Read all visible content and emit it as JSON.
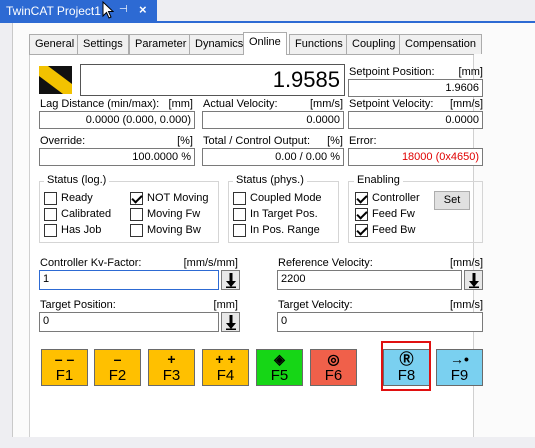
{
  "doc_tab": {
    "title": "TwinCAT Project1",
    "pin_glyph": "⊣",
    "close_glyph": "×"
  },
  "tabs": [
    {
      "label": "General"
    },
    {
      "label": "Settings"
    },
    {
      "label": "Parameter"
    },
    {
      "label": "Dynamics"
    },
    {
      "label": "Online",
      "active": true
    },
    {
      "label": "Functions"
    },
    {
      "label": "Coupling"
    },
    {
      "label": "Compensation"
    }
  ],
  "display": {
    "actual_position": "1.9585"
  },
  "setpoint_position": {
    "label": "Setpoint Position:",
    "unit": "[mm]",
    "value": "1.9606"
  },
  "lag_distance": {
    "label": "Lag Distance (min/max):",
    "unit": "[mm]",
    "value": "0.0000  (0.000, 0.000)"
  },
  "actual_velocity": {
    "label": "Actual Velocity:",
    "unit": "[mm/s]",
    "value": "0.0000"
  },
  "setpoint_velocity": {
    "label": "Setpoint Velocity:",
    "unit": "[mm/s]",
    "value": "0.0000"
  },
  "override": {
    "label": "Override:",
    "unit": "[%]",
    "value": "100.0000 %"
  },
  "output": {
    "label": "Total / Control Output:",
    "unit": "[%]",
    "value": "0.00 /  0.00 %"
  },
  "error": {
    "label": "Error:",
    "value": "18000 (0x4650)"
  },
  "status_log": {
    "title": "Status (log.)",
    "items": [
      {
        "label": "Ready",
        "checked": false
      },
      {
        "label": "Calibrated",
        "checked": false
      },
      {
        "label": "Has Job",
        "checked": false
      },
      {
        "label": "NOT Moving",
        "checked": true
      },
      {
        "label": "Moving Fw",
        "checked": false
      },
      {
        "label": "Moving Bw",
        "checked": false
      }
    ]
  },
  "status_phys": {
    "title": "Status (phys.)",
    "items": [
      {
        "label": "Coupled Mode",
        "checked": false
      },
      {
        "label": "In Target Pos.",
        "checked": false
      },
      {
        "label": "In Pos. Range",
        "checked": false
      }
    ]
  },
  "enabling": {
    "title": "Enabling",
    "items": [
      {
        "label": "Controller",
        "checked": true
      },
      {
        "label": "Feed Fw",
        "checked": true
      },
      {
        "label": "Feed Bw",
        "checked": true
      }
    ],
    "set_label": "Set"
  },
  "kv_factor": {
    "label": "Controller Kv-Factor:",
    "unit": "[mm/s/mm]",
    "value": "1"
  },
  "ref_velocity": {
    "label": "Reference Velocity:",
    "unit": "[mm/s]",
    "value": "2200"
  },
  "target_position": {
    "label": "Target Position:",
    "unit": "[mm]",
    "value": "0"
  },
  "target_velocity": {
    "label": "Target Velocity:",
    "unit": "[mm/s]",
    "value": "0"
  },
  "function_buttons": [
    {
      "key": "F1",
      "symbol": "– –",
      "color": "#ffc000",
      "icon": "fast-backward-icon"
    },
    {
      "key": "F2",
      "symbol": "–",
      "color": "#ffc000",
      "icon": "backward-icon"
    },
    {
      "key": "F3",
      "symbol": "+",
      "color": "#ffc000",
      "icon": "forward-icon"
    },
    {
      "key": "F4",
      "symbol": "+ +",
      "color": "#ffc000",
      "icon": "fast-forward-icon"
    },
    {
      "key": "F5",
      "symbol": "◈",
      "color": "#16d616",
      "icon": "start-icon"
    },
    {
      "key": "F6",
      "symbol": "◎",
      "color": "#f0604a",
      "icon": "stop-icon"
    },
    {
      "key": "F8",
      "symbol": "Ⓡ",
      "color": "#7ad0f0",
      "icon": "reset-icon",
      "highlighted": true
    },
    {
      "key": "F9",
      "symbol": "→•",
      "color": "#7ad0f0",
      "icon": "reference-icon"
    }
  ],
  "colors": {
    "accent": "#2d6ad3",
    "error_text": "#e00000",
    "highlight": "#e01010"
  }
}
